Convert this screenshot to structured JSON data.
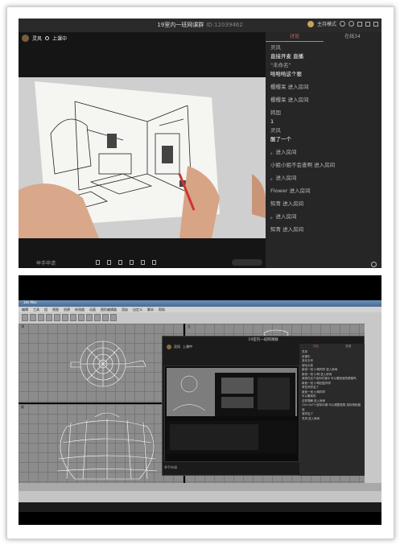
{
  "top": {
    "title": "19室内一班网课群",
    "room_id": "ID:12039462",
    "mode_label": "主持模式",
    "host_name": "灵风",
    "host_status": "上课中",
    "tabs": [
      "讨论",
      "在线34"
    ],
    "messages": [
      {
        "name": "灵风",
        "text": "直接开麦 直播"
      },
      {
        "name": "\"未命名\"",
        "text": "哈哈哈这个狠"
      },
      {
        "system": "樱樱呆 进入房间"
      },
      {
        "system": "樱樱呆 进入房间"
      },
      {
        "name": "韩国",
        "text": "1"
      },
      {
        "name": "灵风",
        "text": "醒了一个"
      },
      {
        "system": "。进入房间"
      },
      {
        "system": "小姐小姐不会查啊 进入房间"
      },
      {
        "system": "。进入房间"
      },
      {
        "system": "Flower 进入房间"
      },
      {
        "system": "知青 进入房间"
      },
      {
        "system": "。进入房间"
      },
      {
        "system": "知青 进入房间"
      }
    ],
    "apply_label": "举手申请"
  },
  "bottom": {
    "app_title": "3ds Max",
    "menu": [
      "编辑",
      "工具",
      "组",
      "视图",
      "创建",
      "修改器",
      "动画",
      "图形编辑器",
      "渲染",
      "自定义",
      "脚本",
      "帮助"
    ],
    "viewports": [
      "顶",
      "前",
      "左",
      "透视"
    ],
    "overlay": {
      "title": "19室内一班网课群",
      "host_name": "灵风",
      "host_status": "上课中",
      "tabs": [
        "讨论",
        "在线"
      ],
      "lines": [
        "灵风",
        "讲课中",
        "浙京五号",
        "哈哈大笑",
        "新浪一班 小明同学 进入房间",
        "新浪一班 小明 进入房间",
        "我现在这个给你们演示 可以看到我的屏幕吗",
        "新浪一班 小明回复同学",
        "有些同学会了",
        "新浪一班 小明同学",
        "可以看到的",
        "这样理解 进入房间",
        "Ctrl+ALT+鼠标中键 可以调整视角 鼠标滚轮缩放",
        "我学会了",
        "灵风 进入房间"
      ],
      "footer": "举手申请"
    }
  },
  "colors": {
    "accent": "#e66666",
    "chat_bg": "#262626"
  }
}
